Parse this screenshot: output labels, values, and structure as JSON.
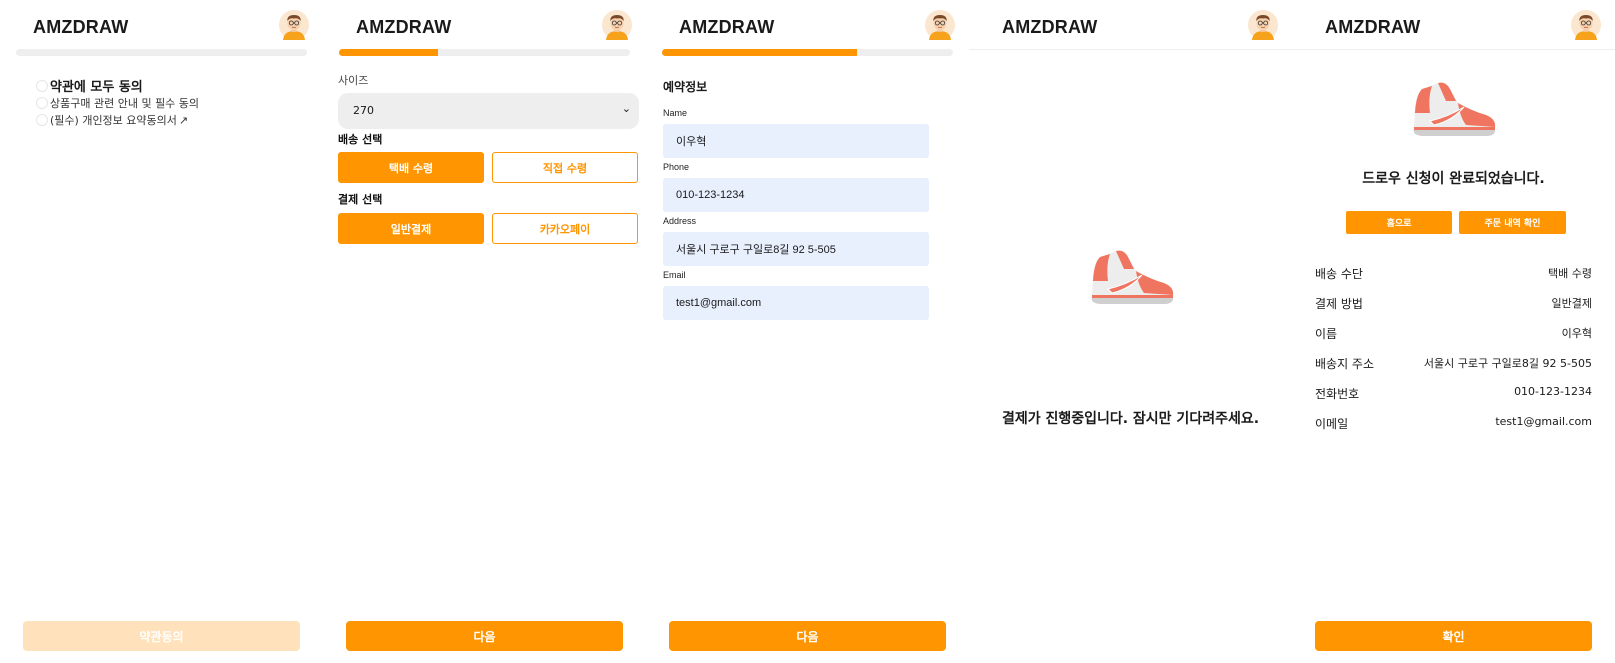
{
  "app": {
    "logo": "AMZDRAW"
  },
  "colors": {
    "accent": "#ff9500",
    "input_bg": "#e8f0fe",
    "track": "#eeeeee"
  },
  "screen1": {
    "progress": 0,
    "agree_all": "약관에 모두 동의",
    "terms": [
      "상품구매 관련 안내 및 필수 동의",
      "(필수) 개인정보 요약동의서"
    ],
    "submit": "약관동의"
  },
  "screen2": {
    "progress": 0.34,
    "size_label": "사이즈",
    "size_value": "270",
    "delivery_label": "배송 선택",
    "delivery_options": [
      "택배 수령",
      "직접 수령"
    ],
    "payment_label": "결제 선택",
    "payment_options": [
      "일반결제",
      "카카오페이"
    ],
    "next": "다음"
  },
  "screen3": {
    "progress": 0.67,
    "title": "예약정보",
    "fields": [
      {
        "label": "Name",
        "value": "이우혁"
      },
      {
        "label": "Phone",
        "value": "010-123-1234"
      },
      {
        "label": "Address",
        "value": "서울시 구로구 구일로8길 92 5-505"
      },
      {
        "label": "Email",
        "value": "test1@gmail.com"
      }
    ],
    "next": "다음"
  },
  "screen4": {
    "message": "결제가 진행중입니다. 잠시만 기다려주세요."
  },
  "screen5": {
    "message": "드로우 신청이 완료되었습니다.",
    "home": "홈으로",
    "orders": "주문 내역 확인",
    "details": [
      {
        "label": "배송 수단",
        "value": "택배 수령"
      },
      {
        "label": "결제 방법",
        "value": "일반결제"
      },
      {
        "label": "이름",
        "value": "이우혁"
      },
      {
        "label": "배송지 주소",
        "value": "서울시 구로구 구일로8길 92 5-505"
      },
      {
        "label": "전화번호",
        "value": "010-123-1234"
      },
      {
        "label": "이메일",
        "value": "test1@gmail.com"
      }
    ],
    "confirm": "확인"
  }
}
